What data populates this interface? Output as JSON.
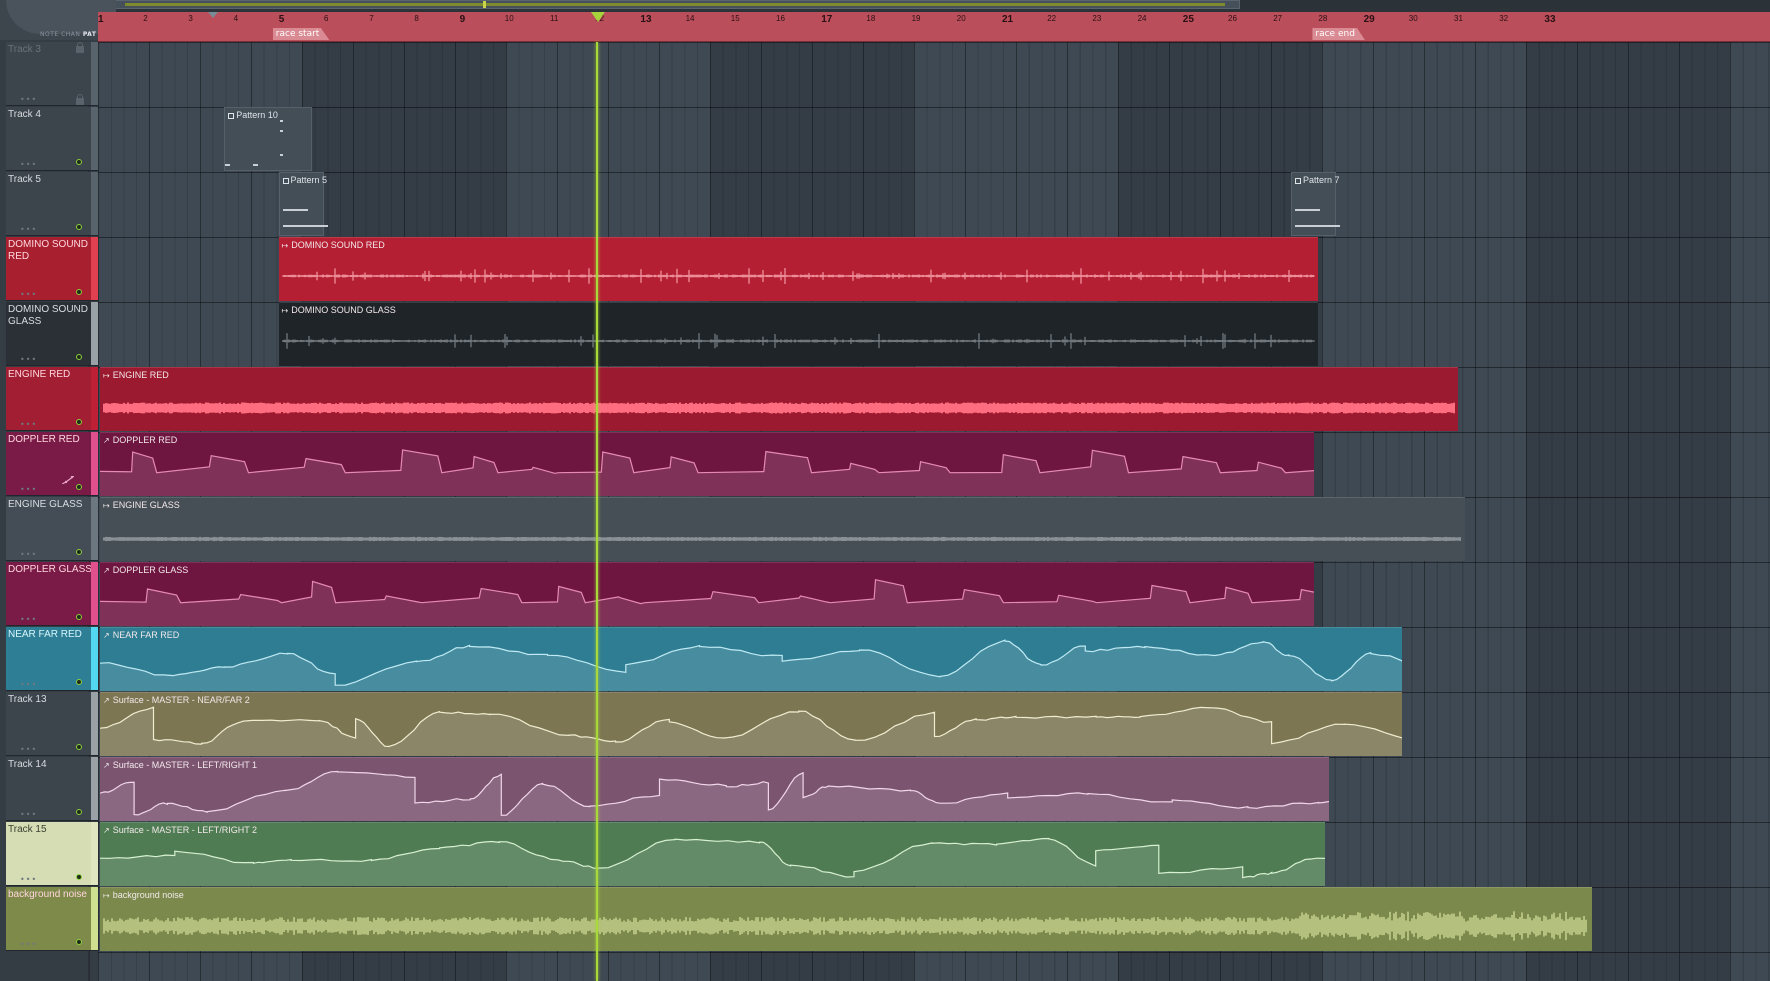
{
  "corner": {
    "modes": [
      "NOTE",
      "CHAN",
      "PAT"
    ],
    "active_mode": "PAT"
  },
  "ruler": {
    "bars": [
      "1",
      "2",
      "3",
      "4",
      "5",
      "6",
      "7",
      "8",
      "9",
      "10",
      "11",
      "12",
      "13",
      "14",
      "15",
      "16",
      "17",
      "18",
      "19",
      "20",
      "21",
      "22",
      "23",
      "24",
      "25",
      "26",
      "27",
      "28",
      "29",
      "30",
      "31",
      "32",
      "33"
    ],
    "markers": [
      {
        "label": "race start",
        "bar": 5
      },
      {
        "label": "race end",
        "bar": 28
      }
    ],
    "playhead_bar": 12
  },
  "tracks": [
    {
      "name": "Track 3",
      "color": "#59636c",
      "locked": true,
      "dim": true
    },
    {
      "name": "Track 4",
      "color": "#59636c"
    },
    {
      "name": "Track 5",
      "color": "#59636c"
    },
    {
      "name": "DOMINO SOUND RED",
      "color": "#e0404f",
      "header_bg": "#a8202f"
    },
    {
      "name": "DOMINO SOUND GLASS",
      "color": "#9aa2a8",
      "header_bg": "#2a3036"
    },
    {
      "name": "ENGINE RED",
      "color": "#c02035",
      "header_bg": "#a21e32"
    },
    {
      "name": "DOPPLER RED",
      "color": "#e0508c",
      "header_bg": "#7a1a46",
      "automation": true
    },
    {
      "name": "ENGINE GLASS",
      "color": "#6c7780",
      "header_bg": "#444d55"
    },
    {
      "name": "DOPPLER GLASS",
      "color": "#e0508c",
      "header_bg": "#7a1a46"
    },
    {
      "name": "NEAR FAR RED",
      "color": "#52d8f0",
      "header_bg": "#2e7f95"
    },
    {
      "name": "Track 13",
      "color": "#9aa2a8",
      "header_bg": "#3c444c"
    },
    {
      "name": "Track 14",
      "color": "#9aa2a8",
      "header_bg": "#3c444c"
    },
    {
      "name": "Track 15",
      "color": "#dfe6c0",
      "header_bg": "#d6dcb4"
    },
    {
      "name": "background noise",
      "color": "#cfe090",
      "header_bg": "#7e8a4a"
    }
  ],
  "patterns": [
    {
      "title": "Pattern 10",
      "track": 1,
      "start": 3.75,
      "end": 5.7
    },
    {
      "title": "Pattern 5",
      "track": 2,
      "start": 4.95,
      "end": 5.95
    },
    {
      "title": "Pattern 7",
      "track": 2,
      "start": 27.35,
      "end": 28.35
    }
  ],
  "clips": [
    {
      "title": "DOMINO SOUND RED",
      "type": "audio",
      "track": 3,
      "start": 4.95,
      "end": 27.95,
      "bg": "#b51f33",
      "wave": "#ffb0b8"
    },
    {
      "title": "DOMINO SOUND GLASS",
      "type": "audio",
      "track": 4,
      "start": 4.95,
      "end": 27.95,
      "bg": "#1f2428",
      "wave": "#8a9298"
    },
    {
      "title": "ENGINE RED",
      "type": "audio",
      "track": 5,
      "start": 1.0,
      "end": 31.05,
      "bg": "#9c1a30",
      "wave": "#ff6e80"
    },
    {
      "title": "DOPPLER RED",
      "type": "automation",
      "track": 6,
      "start": 1.0,
      "end": 27.85,
      "bg": "#6e1540",
      "wave": "#e68ab3"
    },
    {
      "title": "ENGINE GLASS",
      "type": "audio",
      "track": 7,
      "start": 1.0,
      "end": 31.2,
      "bg": "#474f56",
      "wave": "#cbd1d6"
    },
    {
      "title": "DOPPLER GLASS",
      "type": "automation",
      "track": 8,
      "start": 1.0,
      "end": 27.85,
      "bg": "#6e1540",
      "wave": "#e68ab3"
    },
    {
      "title": "NEAR FAR RED",
      "type": "automation",
      "track": 9,
      "start": 1.0,
      "end": 29.8,
      "bg": "#2f7d92",
      "wave": "#bfeaf4"
    },
    {
      "title": "Surface - MASTER - NEAR/FAR 2",
      "type": "automation",
      "track": 10,
      "start": 1.0,
      "end": 29.8,
      "bg": "#7c7652",
      "wave": "#f0ecd0"
    },
    {
      "title": "Surface - MASTER - LEFT/RIGHT 1",
      "type": "automation",
      "track": 11,
      "start": 1.0,
      "end": 28.2,
      "bg": "#7b5470",
      "wave": "#f0d6e8"
    },
    {
      "title": "Surface - MASTER - LEFT/RIGHT 2",
      "type": "automation",
      "track": 12,
      "start": 1.0,
      "end": 28.1,
      "bg": "#4f7c52",
      "wave": "#d6f0d0"
    },
    {
      "title": "background noise",
      "type": "audio",
      "track": 13,
      "start": 1.0,
      "end": 34.0,
      "bg": "#7b8a4c",
      "wave": "#eef5b0"
    }
  ]
}
